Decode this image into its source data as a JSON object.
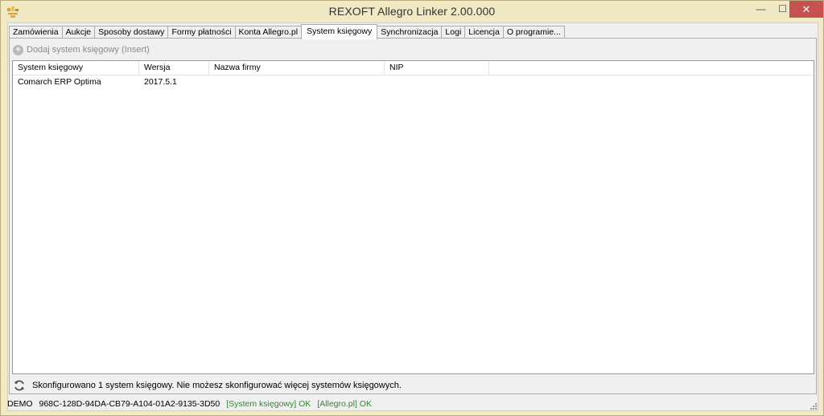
{
  "window": {
    "title": "REXOFT Allegro Linker 2.00.000",
    "minimize_glyph": "—",
    "maximize_glyph": "☐",
    "close_glyph": "✕",
    "icon": "app-icon"
  },
  "tabs": [
    {
      "label": "Zamówienia",
      "active": false
    },
    {
      "label": "Aukcje",
      "active": false
    },
    {
      "label": "Sposoby dostawy",
      "active": false
    },
    {
      "label": "Formy płatności",
      "active": false
    },
    {
      "label": "Konta Allegro.pl",
      "active": false
    },
    {
      "label": "System księgowy",
      "active": true
    },
    {
      "label": "Synchronizacja",
      "active": false
    },
    {
      "label": "Logi",
      "active": false
    },
    {
      "label": "Licencja",
      "active": false
    },
    {
      "label": "O programie...",
      "active": false
    }
  ],
  "toolbar": {
    "add_label": "Dodaj system księgowy (Insert)",
    "add_icon": "plus-circle-icon"
  },
  "grid": {
    "columns": [
      "System księgowy",
      "Wersja",
      "Nazwa firmy",
      "NIP",
      ""
    ],
    "rows": [
      [
        "Comarch ERP Optima",
        "2017.5.1",
        "",
        "",
        ""
      ]
    ]
  },
  "info": {
    "icon": "refresh-icon",
    "text": "Skonfigurowano 1 system księgowy. Nie możesz skonfigurować więcej systemów księgowych."
  },
  "status": {
    "mode": "DEMO",
    "license_key": "968C-128D-94DA-CB79-A104-01A2-9135-3D50",
    "accounting_status": "[System księgowy] OK",
    "allegro_status": "[Allegro.pl] OK",
    "ok_color": "#2e8b2e"
  },
  "colors": {
    "frame": "#f1e8c4",
    "close_button": "#c75050",
    "panel": "#f0f0f0"
  }
}
